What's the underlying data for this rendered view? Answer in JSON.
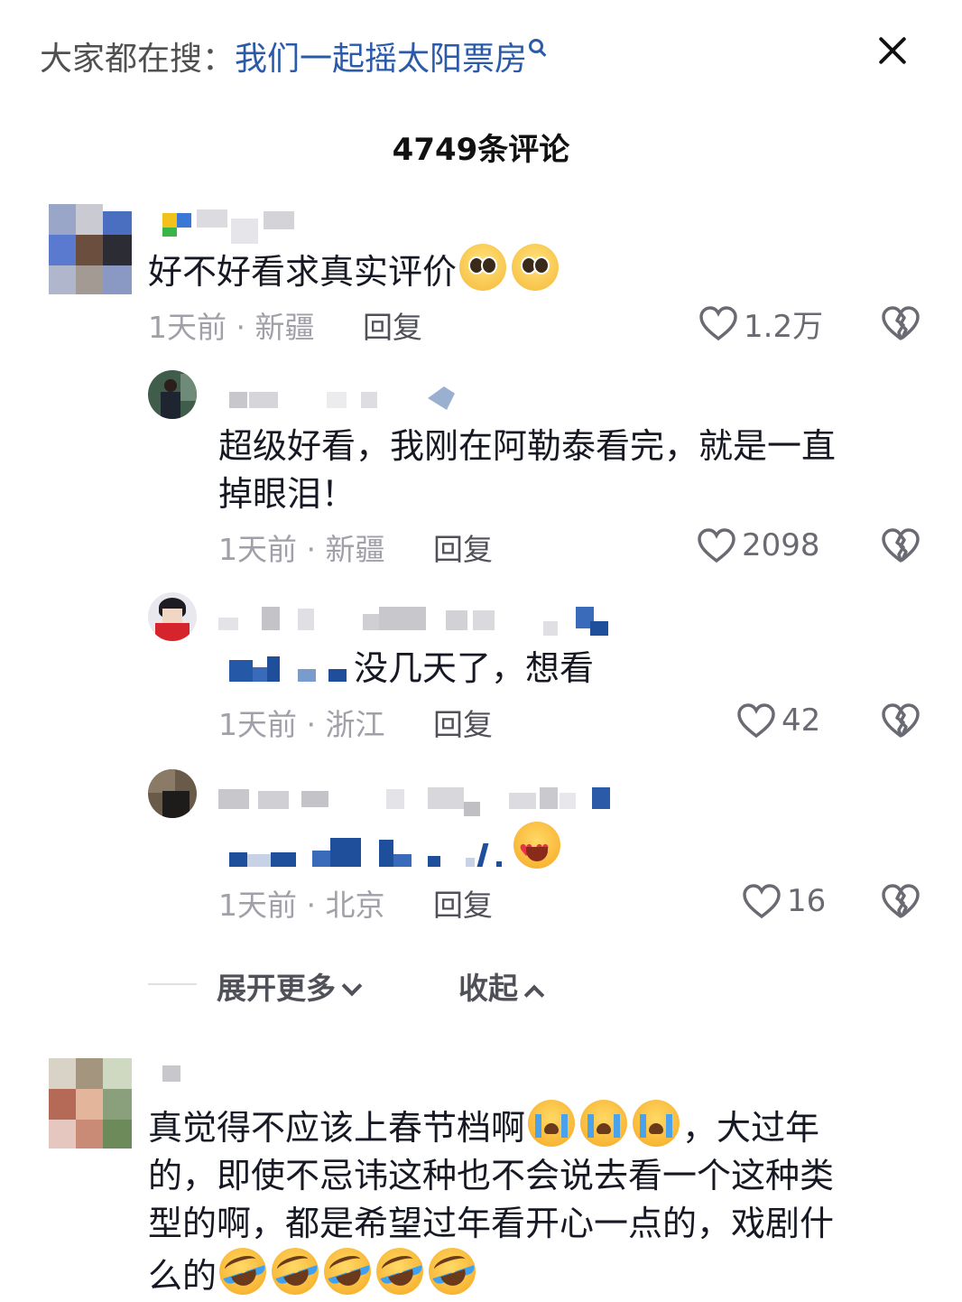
{
  "header": {
    "search_prefix": "大家都在搜：",
    "search_query": "我们一起摇太阳票房"
  },
  "comment_count": "4749条评论",
  "comments": [
    {
      "text": "好不好看求真实评价",
      "emojis": [
        "pleading-face",
        "pleading-face"
      ],
      "time": "1天前",
      "location": "新疆",
      "reply_label": "回复",
      "likes": "1.2万"
    }
  ],
  "replies": [
    {
      "text_line1": "超级好看，我刚在阿勒泰看完，就是一直",
      "text_line2": "掉眼泪！",
      "time": "1天前",
      "location": "新疆",
      "reply_label": "回复",
      "likes": "2098"
    },
    {
      "text": "没几天了，想看",
      "time": "1天前",
      "location": "浙江",
      "reply_label": "回复",
      "likes": "42"
    },
    {
      "emojis": [
        "heart-eyes-face"
      ],
      "time": "1天前",
      "location": "北京",
      "reply_label": "回复",
      "likes": "16"
    }
  ],
  "thread_controls": {
    "expand_label": "展开更多",
    "collapse_label": "收起"
  },
  "second_comment": {
    "line1": "真觉得不应该上春节档啊",
    "line1_emojis": [
      "loudly-crying-face",
      "loudly-crying-face",
      "loudly-crying-face"
    ],
    "line1_tail": "，大过年",
    "line2": "的，即使不忌讳这种也不会说去看一个这种类",
    "line3": "型的啊，都是希望过年看开心一点的，戏剧什",
    "line4": "么的",
    "line4_emojis": [
      "rolling-laughing-face",
      "rolling-laughing-face",
      "rolling-laughing-face",
      "rolling-laughing-face",
      "rolling-laughing-face"
    ]
  },
  "colors": {
    "query_blue": "#2a5aa8",
    "meta_gray": "#a0a0a8",
    "text_dark": "#161823"
  }
}
